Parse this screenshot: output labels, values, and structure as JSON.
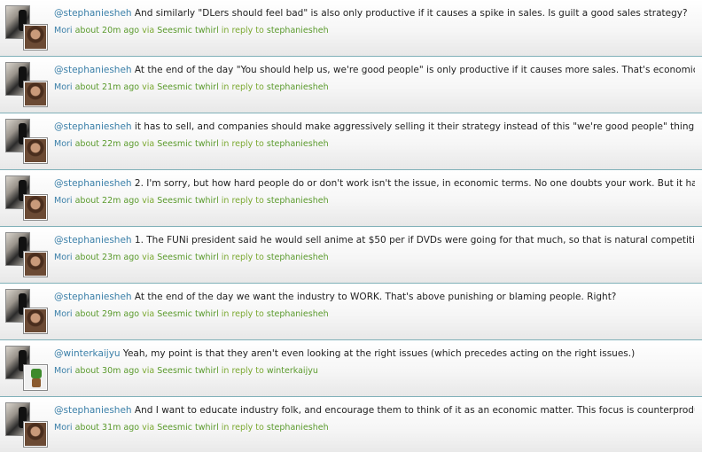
{
  "feed": {
    "items": [
      {
        "mention": "@stephaniesheh",
        "text": " And similarly \"DLers should feel bad\" is also only productive if it causes a spike in sales. Is guilt a good sales strategy?",
        "user": "Mori",
        "time": "about 20m ago",
        "via": "via",
        "app": "Seesmic twhirl",
        "in_reply_to": "in reply to",
        "target": "stephaniesheh",
        "reply_avatar": "woman"
      },
      {
        "mention": "@stephaniesheh",
        "text": " At the end of the day \"You should help us, we're good people\" is only productive if it causes more sales. That's economics.",
        "user": "Mori",
        "time": "about 21m ago",
        "via": "via",
        "app": "Seesmic twhirl",
        "in_reply_to": "in reply to",
        "target": "stephaniesheh",
        "reply_avatar": "woman"
      },
      {
        "mention": "@stephaniesheh",
        "text": " it has to sell, and companies should make aggressively selling it their strategy instead of this \"we're good people\" thing.",
        "user": "Mori",
        "time": "about 22m ago",
        "via": "via",
        "app": "Seesmic twhirl",
        "in_reply_to": "in reply to",
        "target": "stephaniesheh",
        "reply_avatar": "woman"
      },
      {
        "mention": "@stephaniesheh",
        "text": " 2. I'm sorry, but how hard people do or don't work isn't the issue, in economic terms. No one doubts your work. But it has to",
        "user": "Mori",
        "time": "about 22m ago",
        "via": "via",
        "app": "Seesmic twhirl",
        "in_reply_to": "in reply to",
        "target": "stephaniesheh",
        "reply_avatar": "woman"
      },
      {
        "mention": "@stephaniesheh",
        "text": " 1. The FUNi president said he would sell anime at $50 per if DVDs were going for that much, so that is natural competition",
        "user": "Mori",
        "time": "about 23m ago",
        "via": "via",
        "app": "Seesmic twhirl",
        "in_reply_to": "in reply to",
        "target": "stephaniesheh",
        "reply_avatar": "woman"
      },
      {
        "mention": "@stephaniesheh",
        "text": " At the end of the day we want the industry to WORK. That's above punishing or blaming people. Right?",
        "user": "Mori",
        "time": "about 29m ago",
        "via": "via",
        "app": "Seesmic twhirl",
        "in_reply_to": "in reply to",
        "target": "stephaniesheh",
        "reply_avatar": "woman"
      },
      {
        "mention": "@winterkaijyu",
        "text": " Yeah, my point is that they aren't even looking at the right issues (which precedes acting on the right issues.)",
        "user": "Mori",
        "time": "about 30m ago",
        "via": "via",
        "app": "Seesmic twhirl",
        "in_reply_to": "in reply to",
        "target": "winterkaijyu",
        "reply_avatar": "frog"
      },
      {
        "mention": "@stephaniesheh",
        "text": " And I want to educate industry folk, and encourage them to think of it as an economic matter. This focus is counterproductive",
        "user": "Mori",
        "time": "about 31m ago",
        "via": "via",
        "app": "Seesmic twhirl",
        "in_reply_to": "in reply to",
        "target": "stephaniesheh",
        "reply_avatar": "woman"
      }
    ]
  }
}
